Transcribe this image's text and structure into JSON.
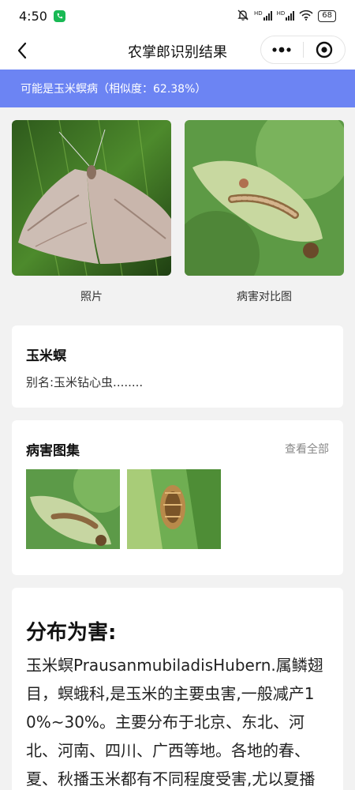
{
  "status_bar": {
    "time": "4:50",
    "battery": "68",
    "signal_label_1": "HD",
    "signal_label_2": "HD",
    "icons": [
      "call-icon",
      "mute-bell-icon",
      "signal-icon",
      "wifi-icon",
      "battery-icon"
    ]
  },
  "nav": {
    "title": "农掌郎识别结果",
    "icons": [
      "back-icon",
      "more-icon",
      "close-target-icon"
    ]
  },
  "banner": {
    "text": "可能是玉米螟病（相似度：62.38%）"
  },
  "photos": {
    "left_caption": "照片",
    "right_caption": "病害对比图"
  },
  "pest_card": {
    "name": "玉米螟",
    "alias": "别名:玉米钻心虫........"
  },
  "gallery_card": {
    "title": "病害图集",
    "view_all": "查看全部"
  },
  "distribution_card": {
    "title": "分布为害:",
    "body": "玉米螟PrausanmubiladisHubern.属鳞翅目，螟蛾科,是玉米的主要虫害,一般减产10%~30%。主要分布于北京、东北、河北、河南、四川、广西等地。各地的春、夏、秋播玉米都有不同程度受害,尤以夏播"
  },
  "colors": {
    "banner_bg": "#6c84f3",
    "call_badge": "#19b954"
  }
}
